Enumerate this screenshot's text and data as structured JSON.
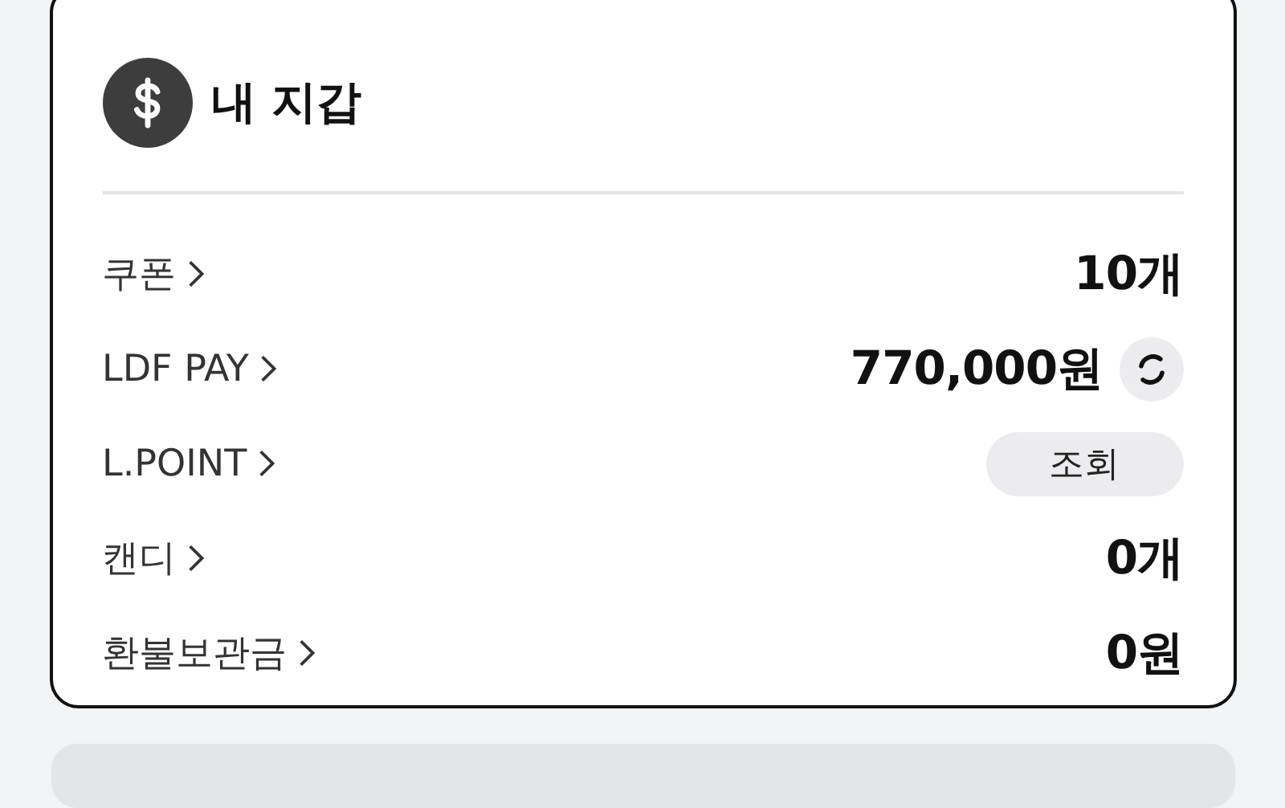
{
  "wallet": {
    "title": "내 지갑",
    "rows": [
      {
        "label": "쿠폰",
        "kind": "value",
        "value": "10개"
      },
      {
        "label": "LDF PAY",
        "kind": "refresh",
        "value": "770,000원"
      },
      {
        "label": "L.POINT",
        "kind": "button",
        "button": "조회"
      },
      {
        "label": "캔디",
        "kind": "value",
        "value": "0개"
      },
      {
        "label": "환불보관금",
        "kind": "value",
        "value": "0원"
      }
    ]
  }
}
